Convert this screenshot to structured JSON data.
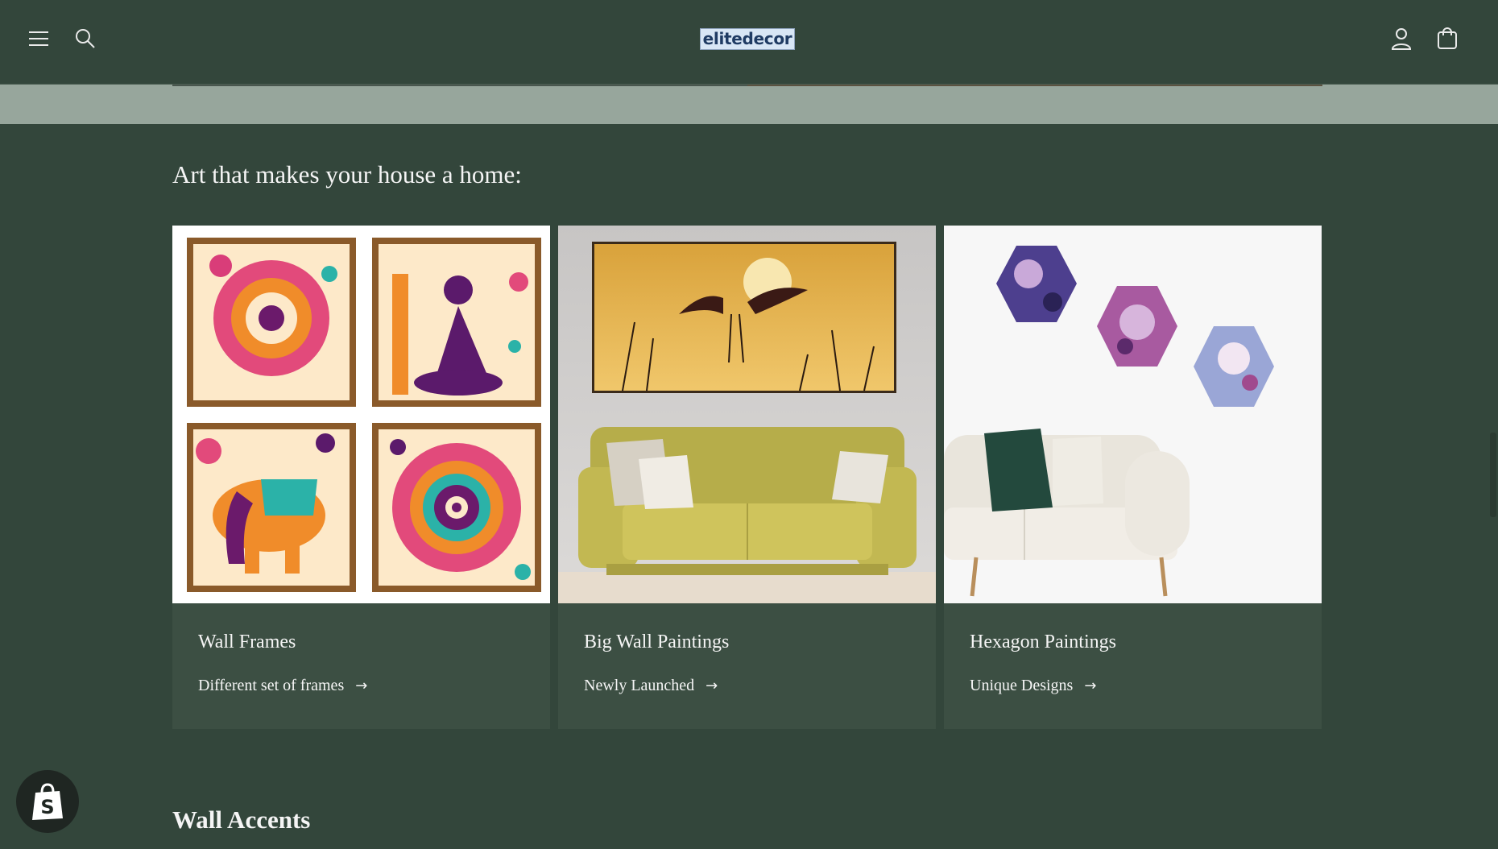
{
  "header": {
    "logo_text": "elitedecor",
    "icons": [
      "menu-icon",
      "search-icon",
      "account-icon",
      "cart-icon"
    ]
  },
  "section": {
    "title": "Art that makes your house a home:"
  },
  "cards": [
    {
      "title": "Wall Frames",
      "link_label": "Different set of frames",
      "image": "four framed folk-art prints"
    },
    {
      "title": "Big Wall Paintings",
      "link_label": "Newly Launched",
      "image": "crane painting above yellow sofa"
    },
    {
      "title": "Hexagon Paintings",
      "link_label": "Unique Designs",
      "image": "three hexagon paintings above white sofa"
    }
  ],
  "next_section": {
    "title": "Wall Accents"
  },
  "colors": {
    "background": "#33463b",
    "card": "#3c4f43",
    "strip": "#97a69c",
    "logo_bg": "#d8e6f5"
  }
}
